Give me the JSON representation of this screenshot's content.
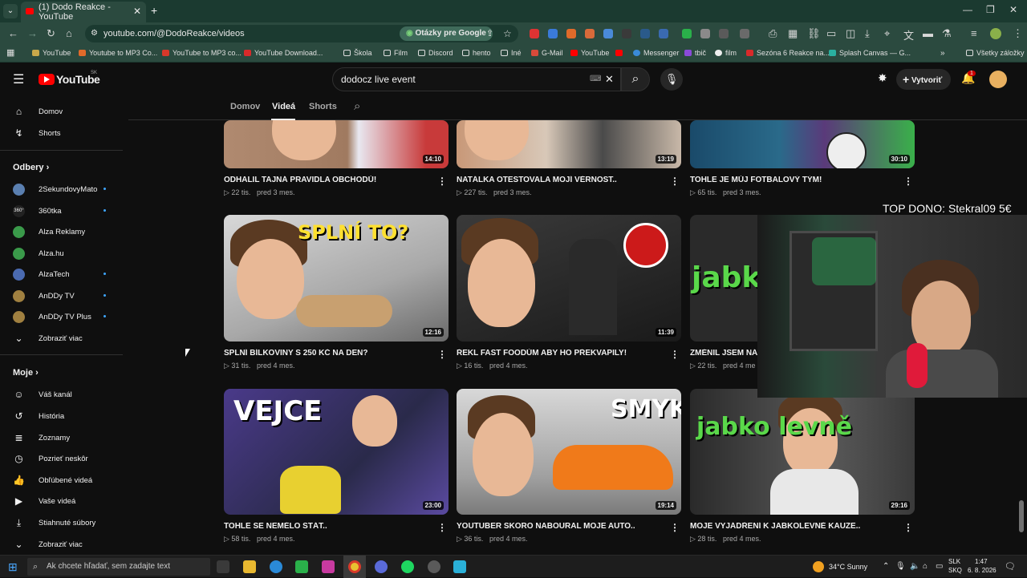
{
  "browser": {
    "tab_title": "(1) Dodo Reakce - YouTube",
    "url": "youtube.com/@DodoReakce/videos",
    "ask_google": "Otázky pre Google",
    "bookmarks": [
      "YouTube",
      "Youtube to MP3 Co...",
      "YouTube to MP3 co...",
      "YouTube Download...",
      "Škola",
      "Film",
      "Discord",
      "hento",
      "Iné",
      "G-Mail",
      "YouTube",
      "",
      "Messenger",
      "tbič",
      "film",
      "Sezóna 6 Reakce na...",
      "Splash Canvas — G..."
    ],
    "all_bookmarks": "Všetky záložky"
  },
  "youtube": {
    "logo": "YouTube",
    "logo_region": "SK",
    "search_value": "dodocz live event",
    "create_label": "Vytvoriť",
    "notif_count": "1"
  },
  "sidebar": {
    "home": "Domov",
    "shorts": "Shorts",
    "subs_header": "Odbery",
    "subscriptions": [
      {
        "name": "2SekundovyMato",
        "color": "#5a7fb0",
        "new": true
      },
      {
        "name": "360tka",
        "color": "#222222",
        "new": true
      },
      {
        "name": "Alza Reklamy",
        "color": "#3a9a4a",
        "new": false
      },
      {
        "name": "Alza.hu",
        "color": "#3a9a4a",
        "new": false
      },
      {
        "name": "AlzaTech",
        "color": "#4a6ab0",
        "new": true
      },
      {
        "name": "AnDDy TV",
        "color": "#a08040",
        "new": true
      },
      {
        "name": "AnDDy TV Plus",
        "color": "#a08040",
        "new": true
      }
    ],
    "show_more": "Zobraziť viac",
    "me_header": "Moje",
    "me_items": [
      "Váš kanál",
      "História",
      "Zoznamy",
      "Pozrieť neskôr",
      "Obľúbené videá",
      "Vaše videá",
      "Stiahnuté súbory",
      "Zobraziť viac"
    ]
  },
  "channel_tabs": [
    "Domov",
    "Videá",
    "Shorts"
  ],
  "videos": [
    {
      "title": "ODHALIL TAJNÁ PRAVIDLA OBCHODŮ!",
      "views": "22 tis.",
      "age": "pred 3 mes.",
      "duration": "14:10",
      "overlay": ""
    },
    {
      "title": "NATÁLKA OTESTOVALA MOJÍ VĚRNOST..",
      "views": "227 tis.",
      "age": "pred 3 mes.",
      "duration": "13:19",
      "overlay": ""
    },
    {
      "title": "TOHLE JE MŮJ FOTBALOVÝ TÝM!",
      "views": "65 tis.",
      "age": "pred 3 mes.",
      "duration": "30:10",
      "overlay": ""
    },
    {
      "title": "SPLNÍ BÍLKOVINY S 250 KČ NA DEN?",
      "views": "31 tis.",
      "age": "pred 4 mes.",
      "duration": "12:16",
      "overlay": "SPLNÍ TO?"
    },
    {
      "title": "ŘEKL FAST FOODŮM ABY HO PŘEKVAPILY!",
      "views": "16 tis.",
      "age": "pred 4 mes.",
      "duration": "11:39",
      "overlay": ""
    },
    {
      "title": "ZMĚNIL JSEM NÁ",
      "views": "22 tis.",
      "age": "pred 4 me",
      "duration": "",
      "overlay": "jabk"
    },
    {
      "title": "TOHLE SE NEMĚLO STÁT..",
      "views": "58 tis.",
      "age": "pred 4 mes.",
      "duration": "23:00",
      "overlay": "VEJCE"
    },
    {
      "title": "YOUTUBER SKORO NABOURAL MOJE AUTO..",
      "views": "36 tis.",
      "age": "pred 4 mes.",
      "duration": "19:14",
      "overlay": "SMYK"
    },
    {
      "title": "MOJE VYJÁDŘENÍ K JABKOLEVNĚ KAUZE..",
      "views": "28 tis.",
      "age": "pred 4 mes.",
      "duration": "29:16",
      "overlay": "jabko levně"
    }
  ],
  "stream_overlay": {
    "donor_text": "TOP DONO: Stekral09 5€"
  },
  "taskbar": {
    "search_placeholder": "Ak chcete hľadať, sem zadajte text",
    "weather": "34°C  Sunny",
    "lang_top": "SLK",
    "lang_bottom": "SKQ",
    "time": "1:47",
    "date": "6. 8. 2026"
  }
}
